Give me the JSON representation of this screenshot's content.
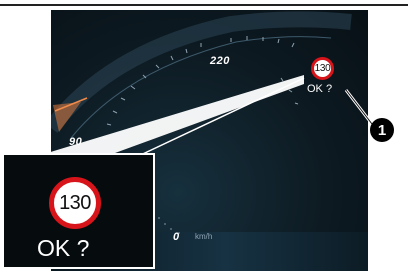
{
  "gauge": {
    "label_high": "220",
    "label_low": "90",
    "speed_value": "0",
    "speed_unit": "km/h"
  },
  "speed_limit_prompt": {
    "limit": "130",
    "question": "OK ?"
  },
  "inset": {
    "limit": "130",
    "question": "OK ?"
  },
  "callout": {
    "number": "1"
  },
  "colors": {
    "sign_border": "#d7141a",
    "cluster_background": "#0d1a22",
    "needle_orange": "#e07a3a"
  }
}
